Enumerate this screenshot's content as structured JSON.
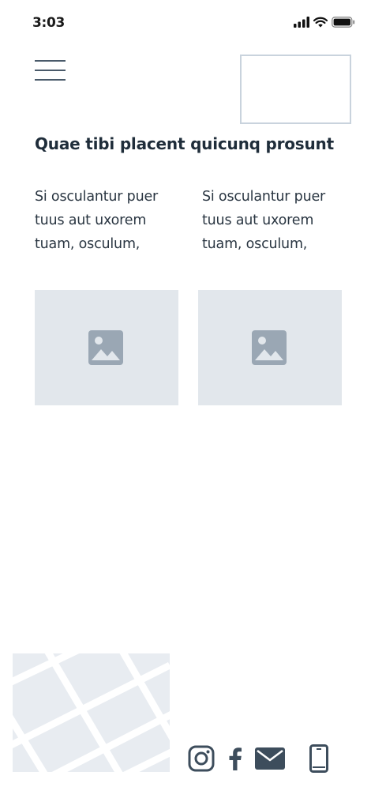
{
  "status_bar": {
    "time": "3:03",
    "icons": [
      "signal-icon",
      "wifi-icon",
      "battery-icon"
    ]
  },
  "header": {
    "menu_icon": "hamburger-menu-icon",
    "logo": "logo-placeholder"
  },
  "main": {
    "title": "Quae tibi placent quicunq prosunt",
    "columns": [
      {
        "text": "Si osculantur puer tuus aut uxorem tuam, osculum,"
      },
      {
        "text": "Si osculantur puer tuus aut uxorem tuam, osculum,"
      }
    ],
    "images": [
      {
        "icon": "image-icon"
      },
      {
        "icon": "image-icon"
      }
    ]
  },
  "footer": {
    "map": "map-thumbnail",
    "social_icons": [
      "instagram-icon",
      "facebook-icon",
      "email-icon",
      "phone-icon"
    ]
  },
  "colors": {
    "text_dark": "#1f2d3a",
    "placeholder_bg": "#e2e7ec",
    "icon_gray": "#9aa7b4",
    "icon_dark": "#4a5a6a",
    "logo_border": "#c9d3dd",
    "map_bg": "#e8ecf1"
  }
}
